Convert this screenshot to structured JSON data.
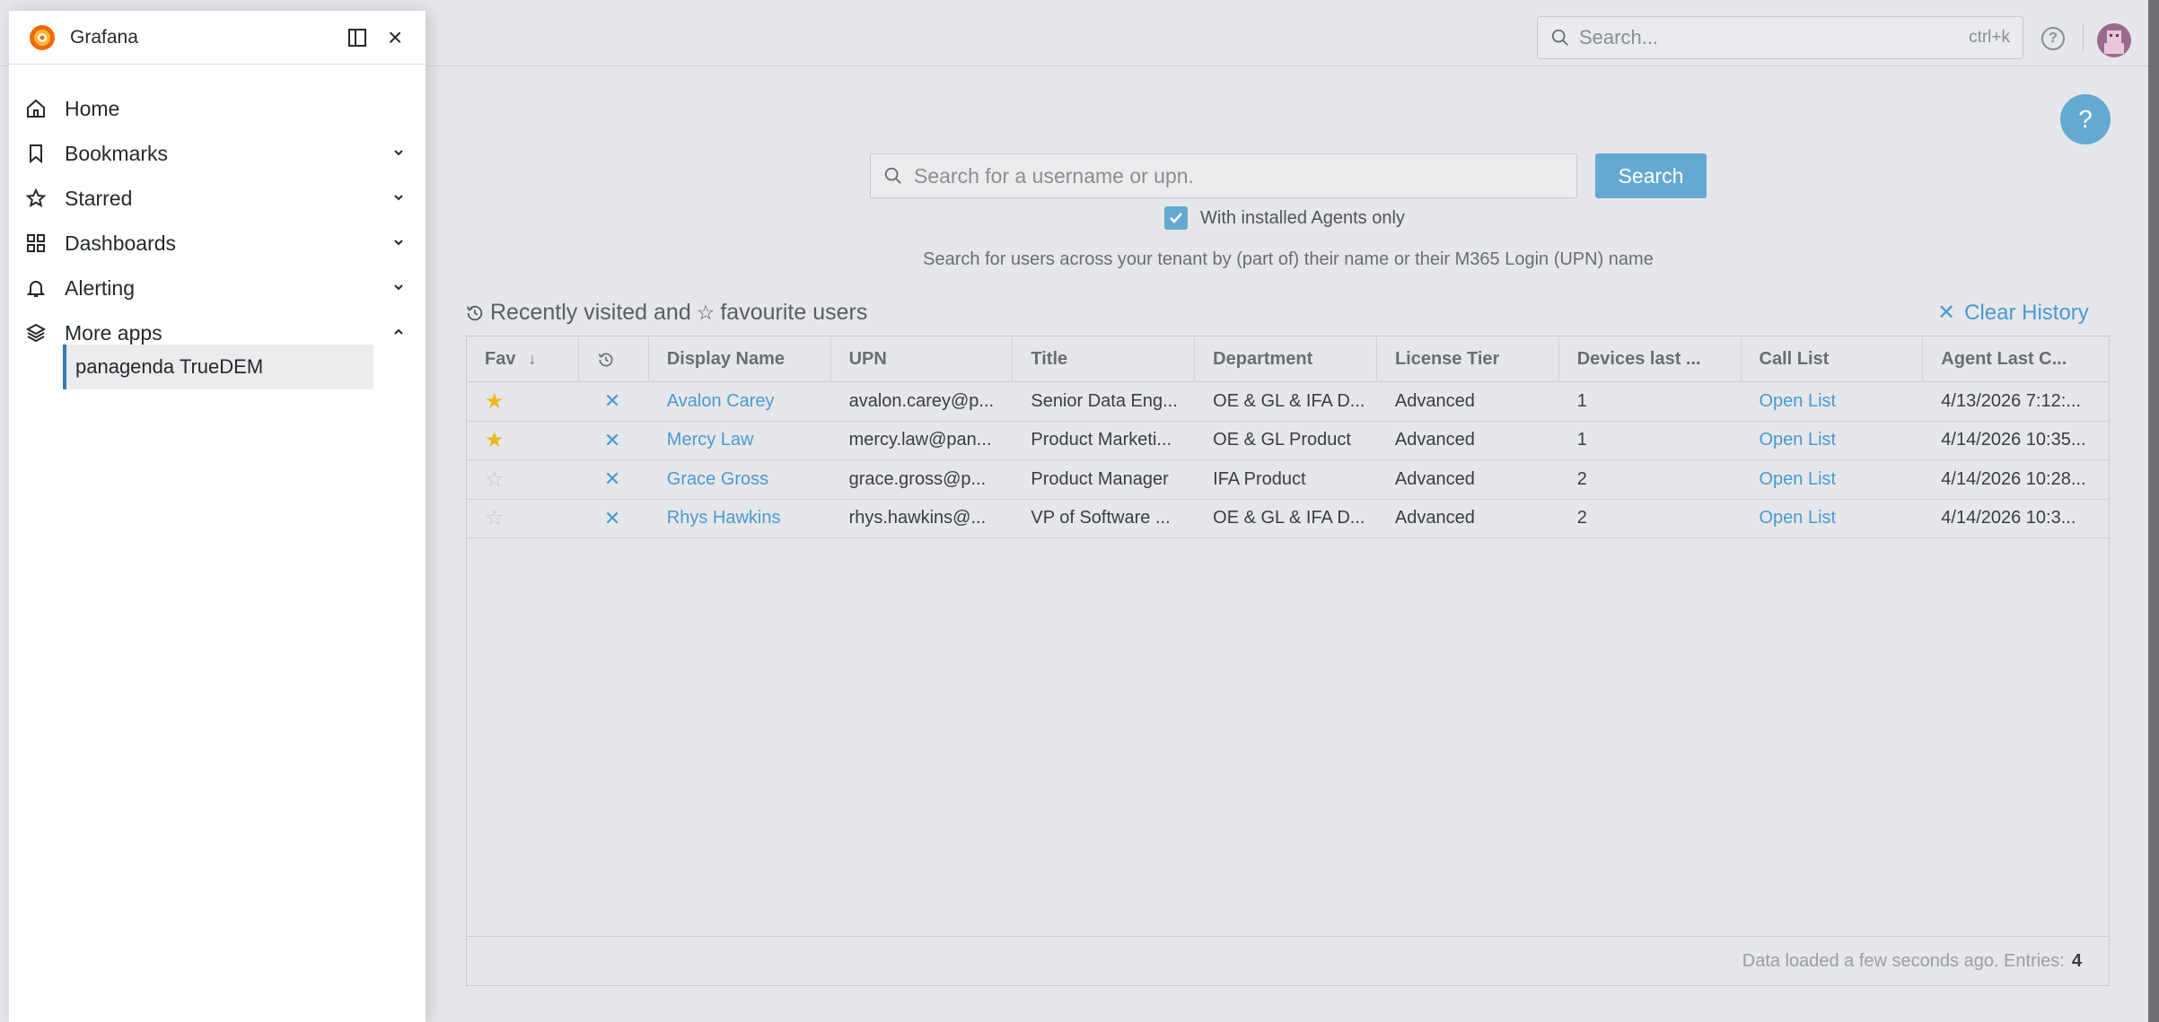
{
  "app": {
    "title": "Grafana"
  },
  "topbar": {
    "search_placeholder": "Search...",
    "search_shortcut": "ctrl+k"
  },
  "help_fab": "?",
  "sidebar": {
    "items": [
      {
        "label": "Home",
        "icon": "home-icon"
      },
      {
        "label": "Bookmarks",
        "icon": "bookmark-icon"
      },
      {
        "label": "Starred",
        "icon": "star-icon"
      },
      {
        "label": "Dashboards",
        "icon": "dashboards-icon"
      },
      {
        "label": "Alerting",
        "icon": "bell-icon"
      },
      {
        "label": "More apps",
        "icon": "layers-icon"
      }
    ],
    "subitem": "panagenda TrueDEM"
  },
  "user_search": {
    "placeholder": "Search for a username or upn.",
    "button": "Search",
    "checkbox_label": "With installed Agents only",
    "checkbox_checked": true,
    "hint": "Search for users across your tenant by (part of) their name or their M365 Login (UPN) name"
  },
  "recent": {
    "title_part1": "Recently visited and",
    "title_part2": "favourite users",
    "clear_label": "Clear History"
  },
  "table": {
    "headers": [
      "Fav",
      "",
      "Display Name",
      "UPN",
      "Title",
      "Department",
      "License Tier",
      "Devices last ...",
      "Call List",
      "Agent Last C..."
    ],
    "rows": [
      {
        "fav": true,
        "name": "Avalon Carey",
        "upn": "avalon.carey@p...",
        "title": "Senior Data Eng...",
        "dept": "OE & GL & IFA D...",
        "tier": "Advanced",
        "devices": "1",
        "call": "Open List",
        "agent": "4/13/2026 7:12:..."
      },
      {
        "fav": true,
        "name": "Mercy Law",
        "upn": "mercy.law@pan...",
        "title": "Product Marketi...",
        "dept": "OE & GL Product",
        "tier": "Advanced",
        "devices": "1",
        "call": "Open List",
        "agent": "4/14/2026 10:35..."
      },
      {
        "fav": false,
        "name": "Grace Gross",
        "upn": "grace.gross@p...",
        "title": "Product Manager",
        "dept": "IFA Product",
        "tier": "Advanced",
        "devices": "2",
        "call": "Open List",
        "agent": "4/14/2026 10:28..."
      },
      {
        "fav": false,
        "name": "Rhys Hawkins",
        "upn": "rhys.hawkins@...",
        "title": "VP of Software ...",
        "dept": "OE & GL & IFA D...",
        "tier": "Advanced",
        "devices": "2",
        "call": "Open List",
        "agent": "4/14/2026 10:3..."
      }
    ],
    "footer_text": "Data loaded a few seconds ago.  Entries:",
    "footer_count": "4"
  }
}
